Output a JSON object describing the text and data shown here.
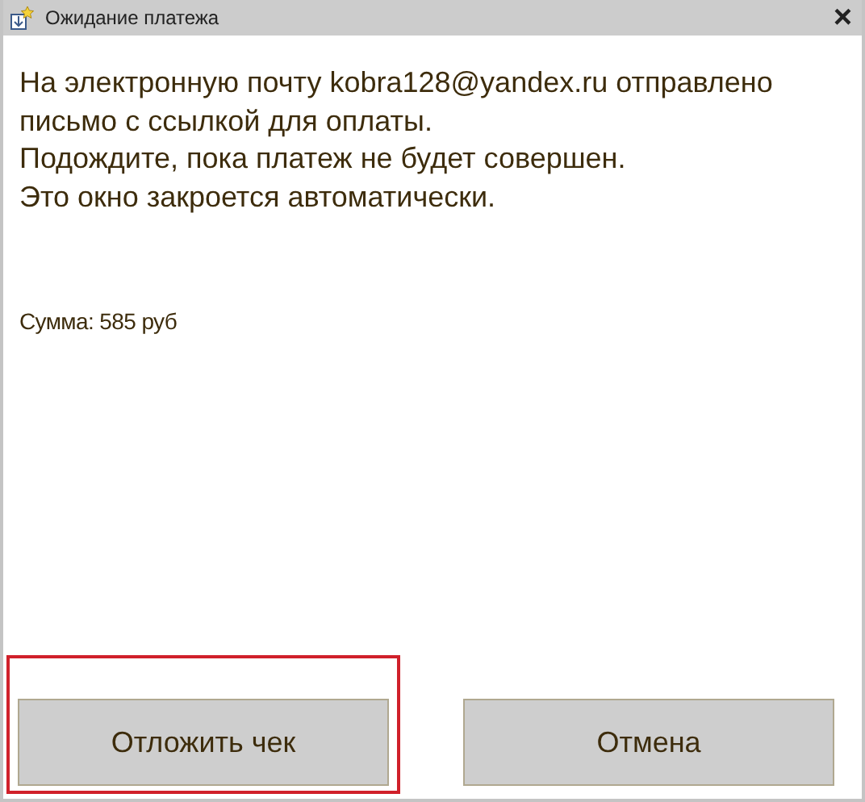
{
  "window": {
    "title": "Ожидание платежа",
    "close": "×"
  },
  "message": [
    "На электронную почту kobra128@yandex.ru отправлено",
    "письмо с ссылкой для оплаты.",
    "Подождите, пока платеж не будет совершен.",
    "Это окно закроется автоматически."
  ],
  "sum": "Сумма: 585 руб",
  "buttons": [
    {
      "label": "Отложить чек",
      "highlighted": true
    },
    {
      "label": "Отмена",
      "highlighted": false
    }
  ]
}
